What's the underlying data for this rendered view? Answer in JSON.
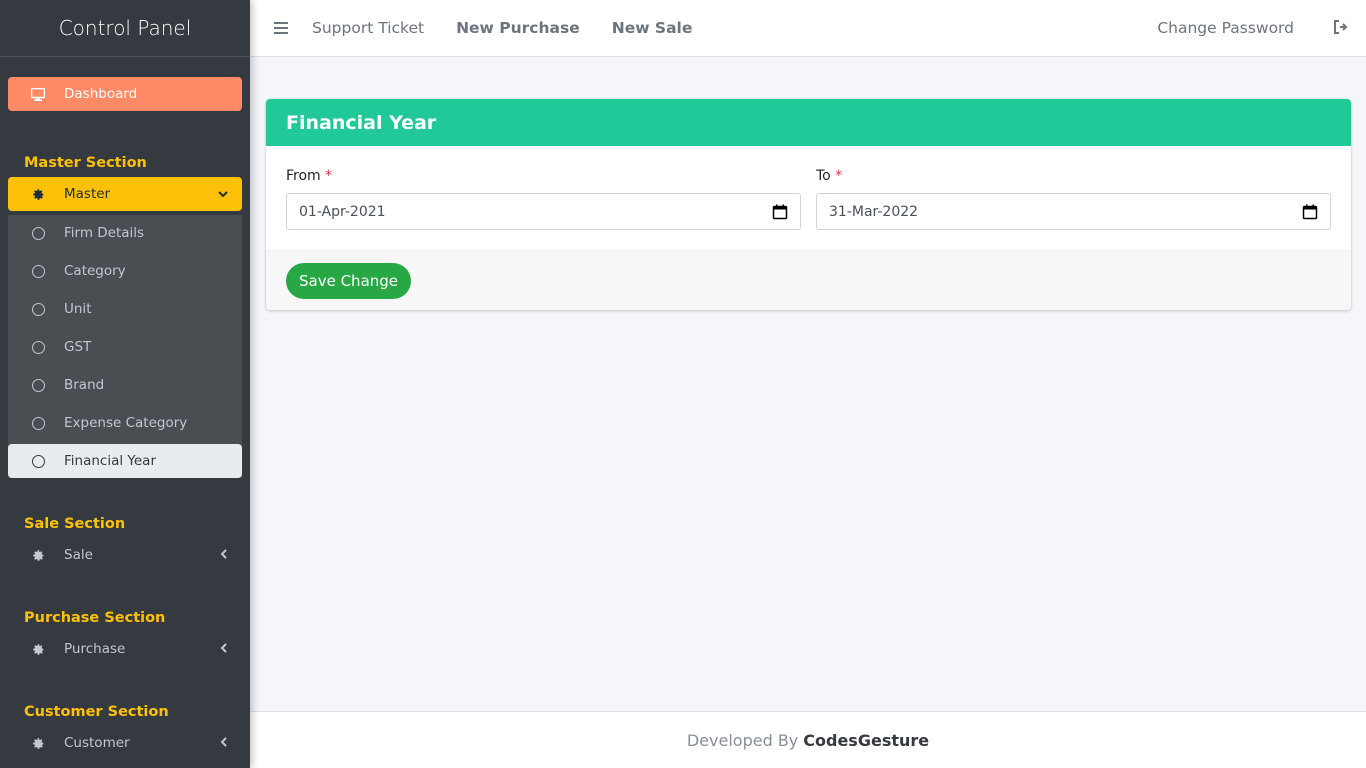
{
  "sidebar": {
    "brand": "Control Panel",
    "dashboard": "Dashboard",
    "sections": {
      "master": "Master Section",
      "sale": "Sale Section",
      "purchase": "Purchase Section",
      "customer": "Customer Section"
    },
    "master_menu": "Master",
    "master_items": [
      "Firm Details",
      "Category",
      "Unit",
      "GST",
      "Brand",
      "Expense Category",
      "Financial Year"
    ],
    "sale_menu": "Sale",
    "purchase_menu": "Purchase",
    "customer_menu": "Customer"
  },
  "topbar": {
    "support": "Support Ticket",
    "new_purchase": "New Purchase",
    "new_sale": "New Sale",
    "change_password": "Change Password"
  },
  "card": {
    "title": "Financial Year",
    "from_label": "From",
    "to_label": "To",
    "required_mark": "*",
    "from_value": "01-Apr-2021",
    "to_value": "31-Mar-2022",
    "save_label": "Save Change"
  },
  "footer": {
    "prefix": "Developed By",
    "brand": "CodesGesture"
  },
  "colors": {
    "sidebar_bg": "#343a40",
    "dashboard": "#ff8a65",
    "master": "#ffc107",
    "card_header": "#20c997",
    "save_button": "#28a745"
  },
  "icons": {
    "menu": "hamburger-icon",
    "logout": "logout-icon",
    "dashboard": "desktop-icon",
    "master": "gear-icon",
    "submenu": "circle-icon",
    "date": "calendar-icon"
  }
}
